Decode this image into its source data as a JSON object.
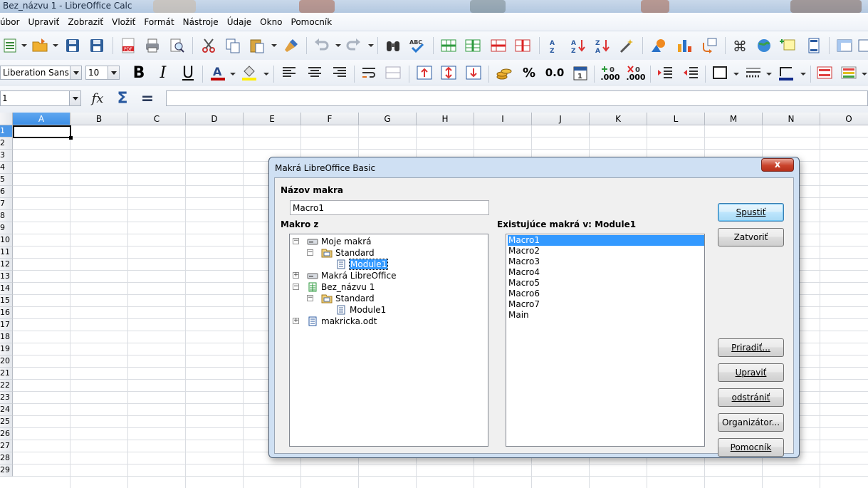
{
  "window": {
    "title": "Bez_názvu 1 - LibreOffice Calc"
  },
  "menu": [
    {
      "label": "Súbor",
      "shown": "úbor"
    },
    {
      "label": "Upraviť"
    },
    {
      "label": "Zobraziť"
    },
    {
      "label": "Vložiť"
    },
    {
      "label": "Formát"
    },
    {
      "label": "Nástroje"
    },
    {
      "label": "Údaje"
    },
    {
      "label": "Okno"
    },
    {
      "label": "Pomocník"
    }
  ],
  "format_toolbar": {
    "font_name": "Liberation Sans",
    "font_size": "10",
    "bold": "B",
    "italic": "I",
    "underline": "U",
    "percent": "%",
    "number": "0.0",
    "add_decimal": ".000",
    "del_decimal": ".000"
  },
  "formula_bar": {
    "name_box": "1",
    "fx": "fx",
    "sigma": "Σ",
    "equals": "="
  },
  "sheet": {
    "columns": [
      "A",
      "B",
      "C",
      "D",
      "E",
      "F",
      "G",
      "H",
      "I",
      "J",
      "K",
      "L",
      "M",
      "N",
      "O"
    ],
    "selected_column": "A",
    "rows": [
      "1",
      "2",
      "3",
      "4",
      "5",
      "6",
      "7",
      "8",
      "9",
      "10",
      "11",
      "12",
      "13",
      "14",
      "15",
      "16",
      "17",
      "18",
      "19",
      "20",
      "21",
      "22",
      "23",
      "24",
      "25",
      "26",
      "27",
      "28",
      "29"
    ],
    "selected_row": "1"
  },
  "dialog": {
    "title": "Makrá LibreOffice Basic",
    "close_label": "x",
    "macro_name_label": "Názov makra",
    "macro_name_value": "Macro1",
    "macro_from_label": "Makro z",
    "existing_label": "Existujúce makrá v: Module1",
    "tree": [
      {
        "label": "Moje makrá",
        "level": 0,
        "expander": "−",
        "icon": "drive-icon"
      },
      {
        "label": "Standard",
        "level": 1,
        "expander": "−",
        "icon": "library-icon"
      },
      {
        "label": "Module1",
        "level": 2,
        "expander": "",
        "icon": "module-icon",
        "selected": true
      },
      {
        "label": "Makrá LibreOffice",
        "level": 0,
        "expander": "+",
        "icon": "drive-icon"
      },
      {
        "label": "Bez_názvu 1",
        "level": 0,
        "expander": "−",
        "icon": "spreadsheet-doc-icon"
      },
      {
        "label": "Standard",
        "level": 1,
        "expander": "−",
        "icon": "library-icon"
      },
      {
        "label": "Module1",
        "level": 2,
        "expander": "",
        "icon": "module-icon"
      },
      {
        "label": "makricka.odt",
        "level": 0,
        "expander": "+",
        "icon": "text-doc-icon"
      }
    ],
    "macros": [
      "Macro1",
      "Macro2",
      "Macro3",
      "Macro4",
      "Macro5",
      "Macro6",
      "Macro7",
      "Main"
    ],
    "selected_macro": "Macro1",
    "buttons": {
      "run": "Spustiť",
      "close": "Zatvoriť",
      "assign": "Priradiť...",
      "edit": "Upraviť",
      "delete": "odstrániť",
      "organizer": "Organizátor...",
      "help": "Pomocník"
    }
  },
  "colors": {
    "selection": "#3399ff",
    "header_selected": "#4b97e8",
    "close_button": "#c9432c",
    "dialog_frame": "#cfe0f3"
  }
}
